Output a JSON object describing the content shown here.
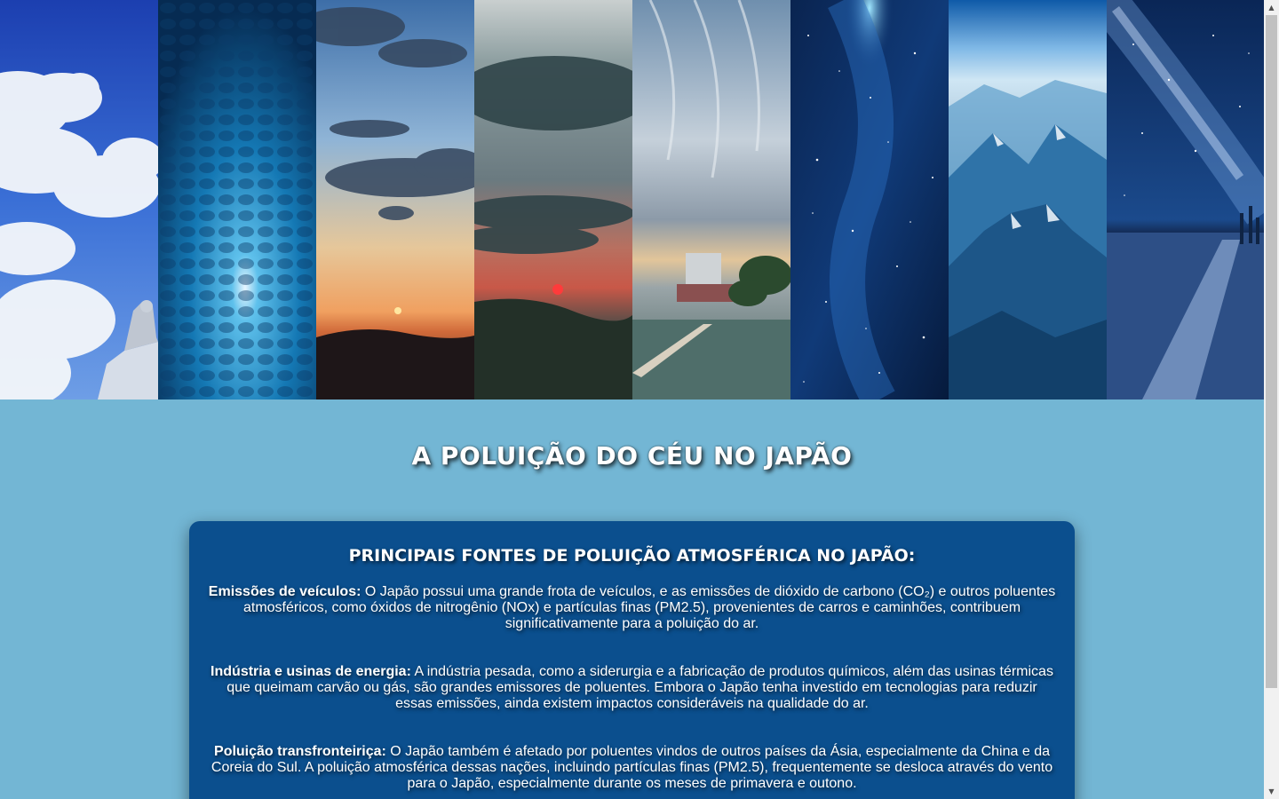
{
  "hero": {
    "panels": [
      {
        "name": "cloudy-sky-with-statue",
        "icon": "sky-clouds-image"
      },
      {
        "name": "altocumulus-sun",
        "icon": "sky-texture-image"
      },
      {
        "name": "sunset-clouds",
        "icon": "sunset-image"
      },
      {
        "name": "red-sun-smog",
        "icon": "smog-sunset-image"
      },
      {
        "name": "rooftop-pool-cirrus",
        "icon": "city-pool-image"
      },
      {
        "name": "night-sky-stars",
        "icon": "starfield-image"
      },
      {
        "name": "blue-mountains",
        "icon": "mountains-image"
      },
      {
        "name": "milky-way-road",
        "icon": "milky-way-image"
      }
    ]
  },
  "page": {
    "title": "A poluição do céu no Japão"
  },
  "card": {
    "title": "Principais fontes de poluição atmosférica no Japão:",
    "items": [
      {
        "label": "Emissões de veículos:",
        "text": " O Japão possui uma grande frota de veículos, e as emissões de dióxido de carbono (CO₂) e outros poluentes atmosféricos, como óxidos de nitrogênio (NOx) e partículas finas (PM2.5), provenientes de carros e caminhões, contribuem significativamente para a poluição do ar."
      },
      {
        "label": "Indústria e usinas de energia:",
        "text": " A indústria pesada, como a siderurgia e a fabricação de produtos químicos, além das usinas térmicas que queimam carvão ou gás, são grandes emissores de poluentes. Embora o Japão tenha investido em tecnologias para reduzir essas emissões, ainda existem impactos consideráveis na qualidade do ar."
      },
      {
        "label": "Poluição transfronteiriça:",
        "text": " O Japão também é afetado por poluentes vindos de outros países da Ásia, especialmente da China e da Coreia do Sul. A poluição atmosférica dessas nações, incluindo partículas finas (PM2.5), frequentemente se desloca através do vento para o Japão, especialmente durante os meses de primavera e outono."
      }
    ]
  },
  "colors": {
    "background": "#73b6d4",
    "card": "#0b4f8e",
    "text": "#ffffff"
  },
  "scrollbar": {
    "up_icon": "scroll-up-arrow-icon",
    "down_icon": "scroll-down-arrow-icon"
  }
}
